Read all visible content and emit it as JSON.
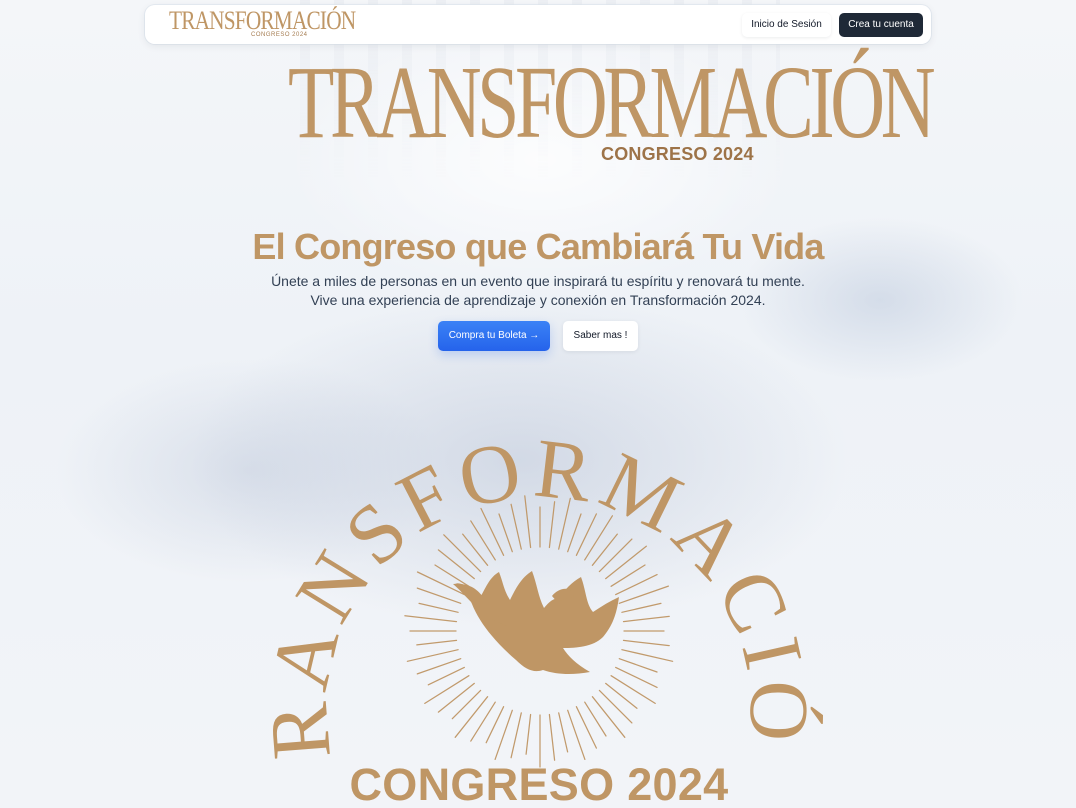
{
  "navbar": {
    "brand": "TRANSFORMACIÓN",
    "brand_sub": "CONGRESO 2024",
    "login_label": "Inicio de Sesión",
    "register_label": "Crea tu cuenta"
  },
  "hero": {
    "logo_title": "TRANSFORMACIÓN",
    "logo_sub": "CONGRESO 2024",
    "headline": "El Congreso que Cambiará Tu Vida",
    "lead": "Únete a miles de personas en un evento que inspirará tu espíritu y renovará tu mente. Vive una experiencia de aprendizaje y conexión en Transformación 2024.",
    "buy_label": "Compra tu Boleta →",
    "more_label": "Saber mas !"
  },
  "emblem": {
    "arc_text": "TRANSFORMACIÓN",
    "bottom_text": "CONGRESO 2024",
    "icon": "dove-icon"
  },
  "colors": {
    "gold": "#bf9665",
    "gold_dark": "#9d7348",
    "dark": "#1f2937",
    "blue": "#2563eb",
    "text": "#334155"
  }
}
